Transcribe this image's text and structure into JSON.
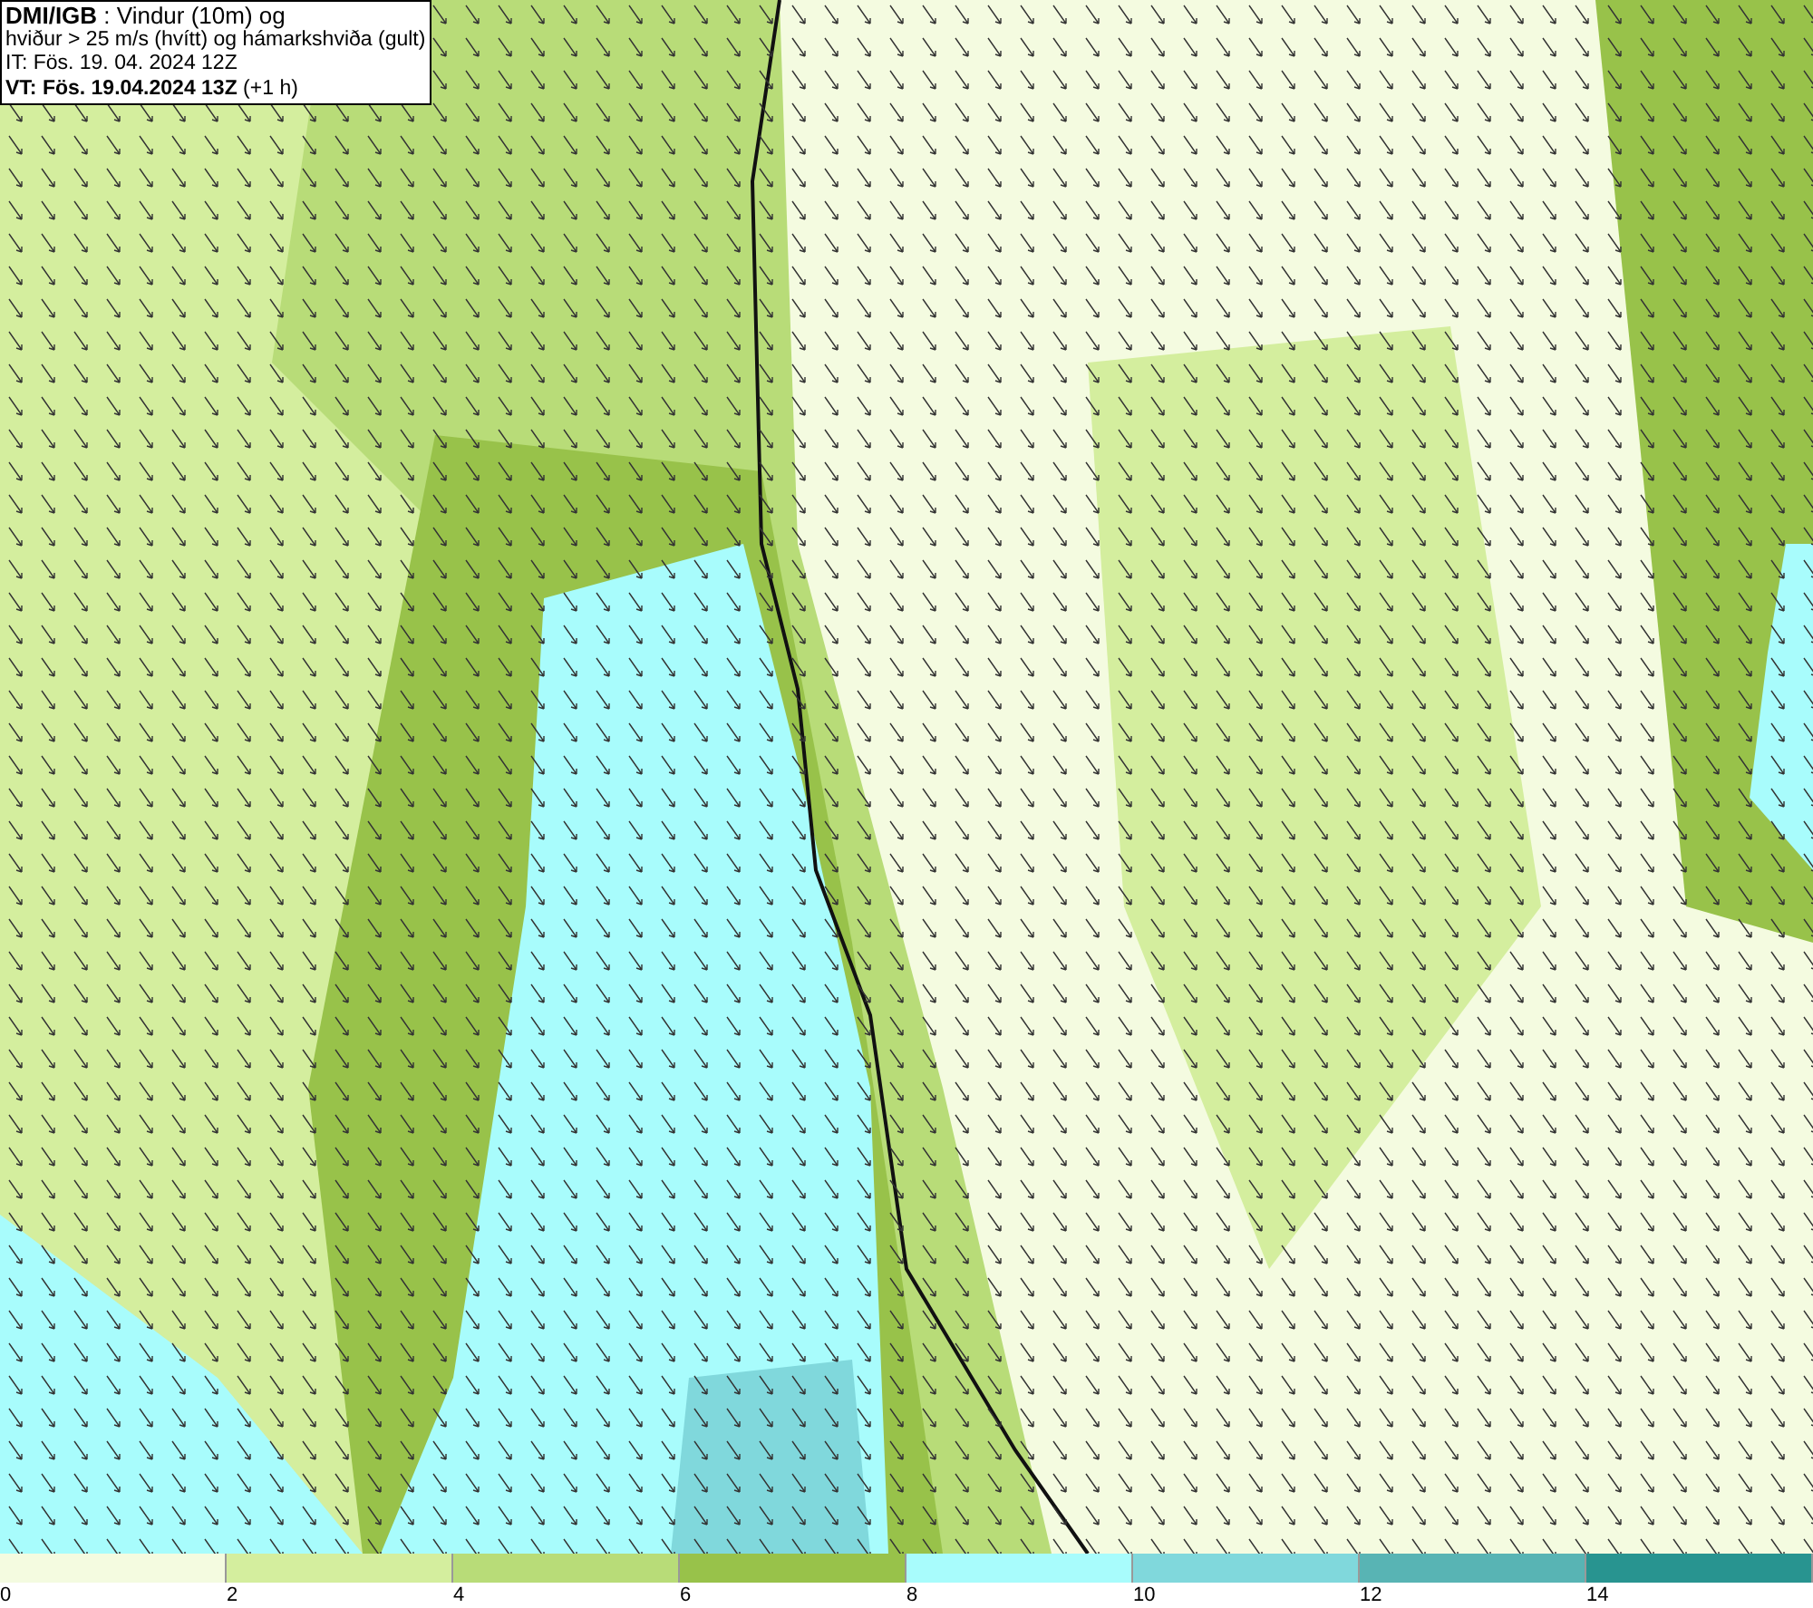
{
  "info_box": {
    "lines": [
      "**DMI/IGB** : Vindur (10m) og",
      "hviður > 25 m/s (hvítt) og hámarkshviða (gult)",
      "IT: Fös. 19. 04. 2024 12Z",
      "**VT: Fös. 19.04.2024 13Z** (+1 h)"
    ]
  },
  "legend": {
    "items": [
      {
        "label": "0",
        "color": "#f4fbe0"
      },
      {
        "label": "2",
        "color": "#d4ee9e"
      },
      {
        "label": "4",
        "color": "#b8dc78"
      },
      {
        "label": "6",
        "color": "#98c24a"
      },
      {
        "label": "8",
        "color": "#a8fcfc"
      },
      {
        "label": "10",
        "color": "#80d8dc"
      },
      {
        "label": "12",
        "color": "#58b4b4"
      },
      {
        "label": "14",
        "color": "#289490"
      }
    ]
  }
}
